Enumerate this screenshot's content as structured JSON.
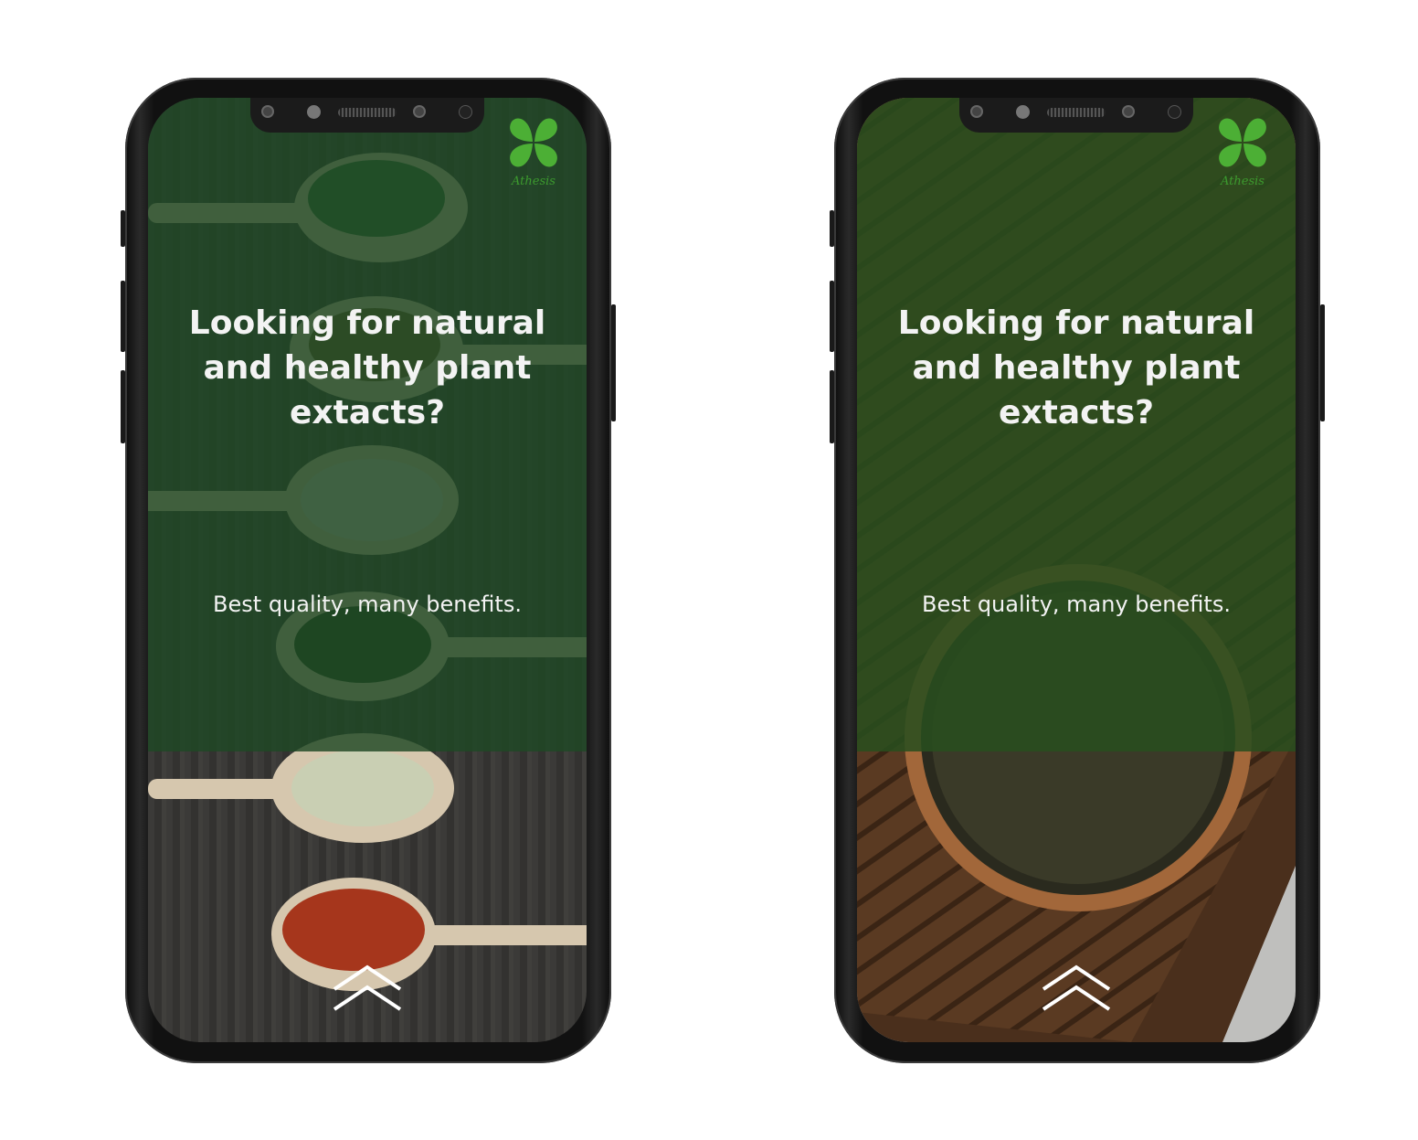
{
  "screens": [
    {
      "brand": "Athesis",
      "headline": "Looking for natural and healthy plant extacts?",
      "tagline": "Best quality, many benefits."
    },
    {
      "brand": "Athesis",
      "headline": "Looking for natural and healthy plant extacts?",
      "tagline": "Best quality, many benefits."
    }
  ],
  "colors": {
    "overlay": "#1e4824",
    "logo": "#4caf35"
  }
}
